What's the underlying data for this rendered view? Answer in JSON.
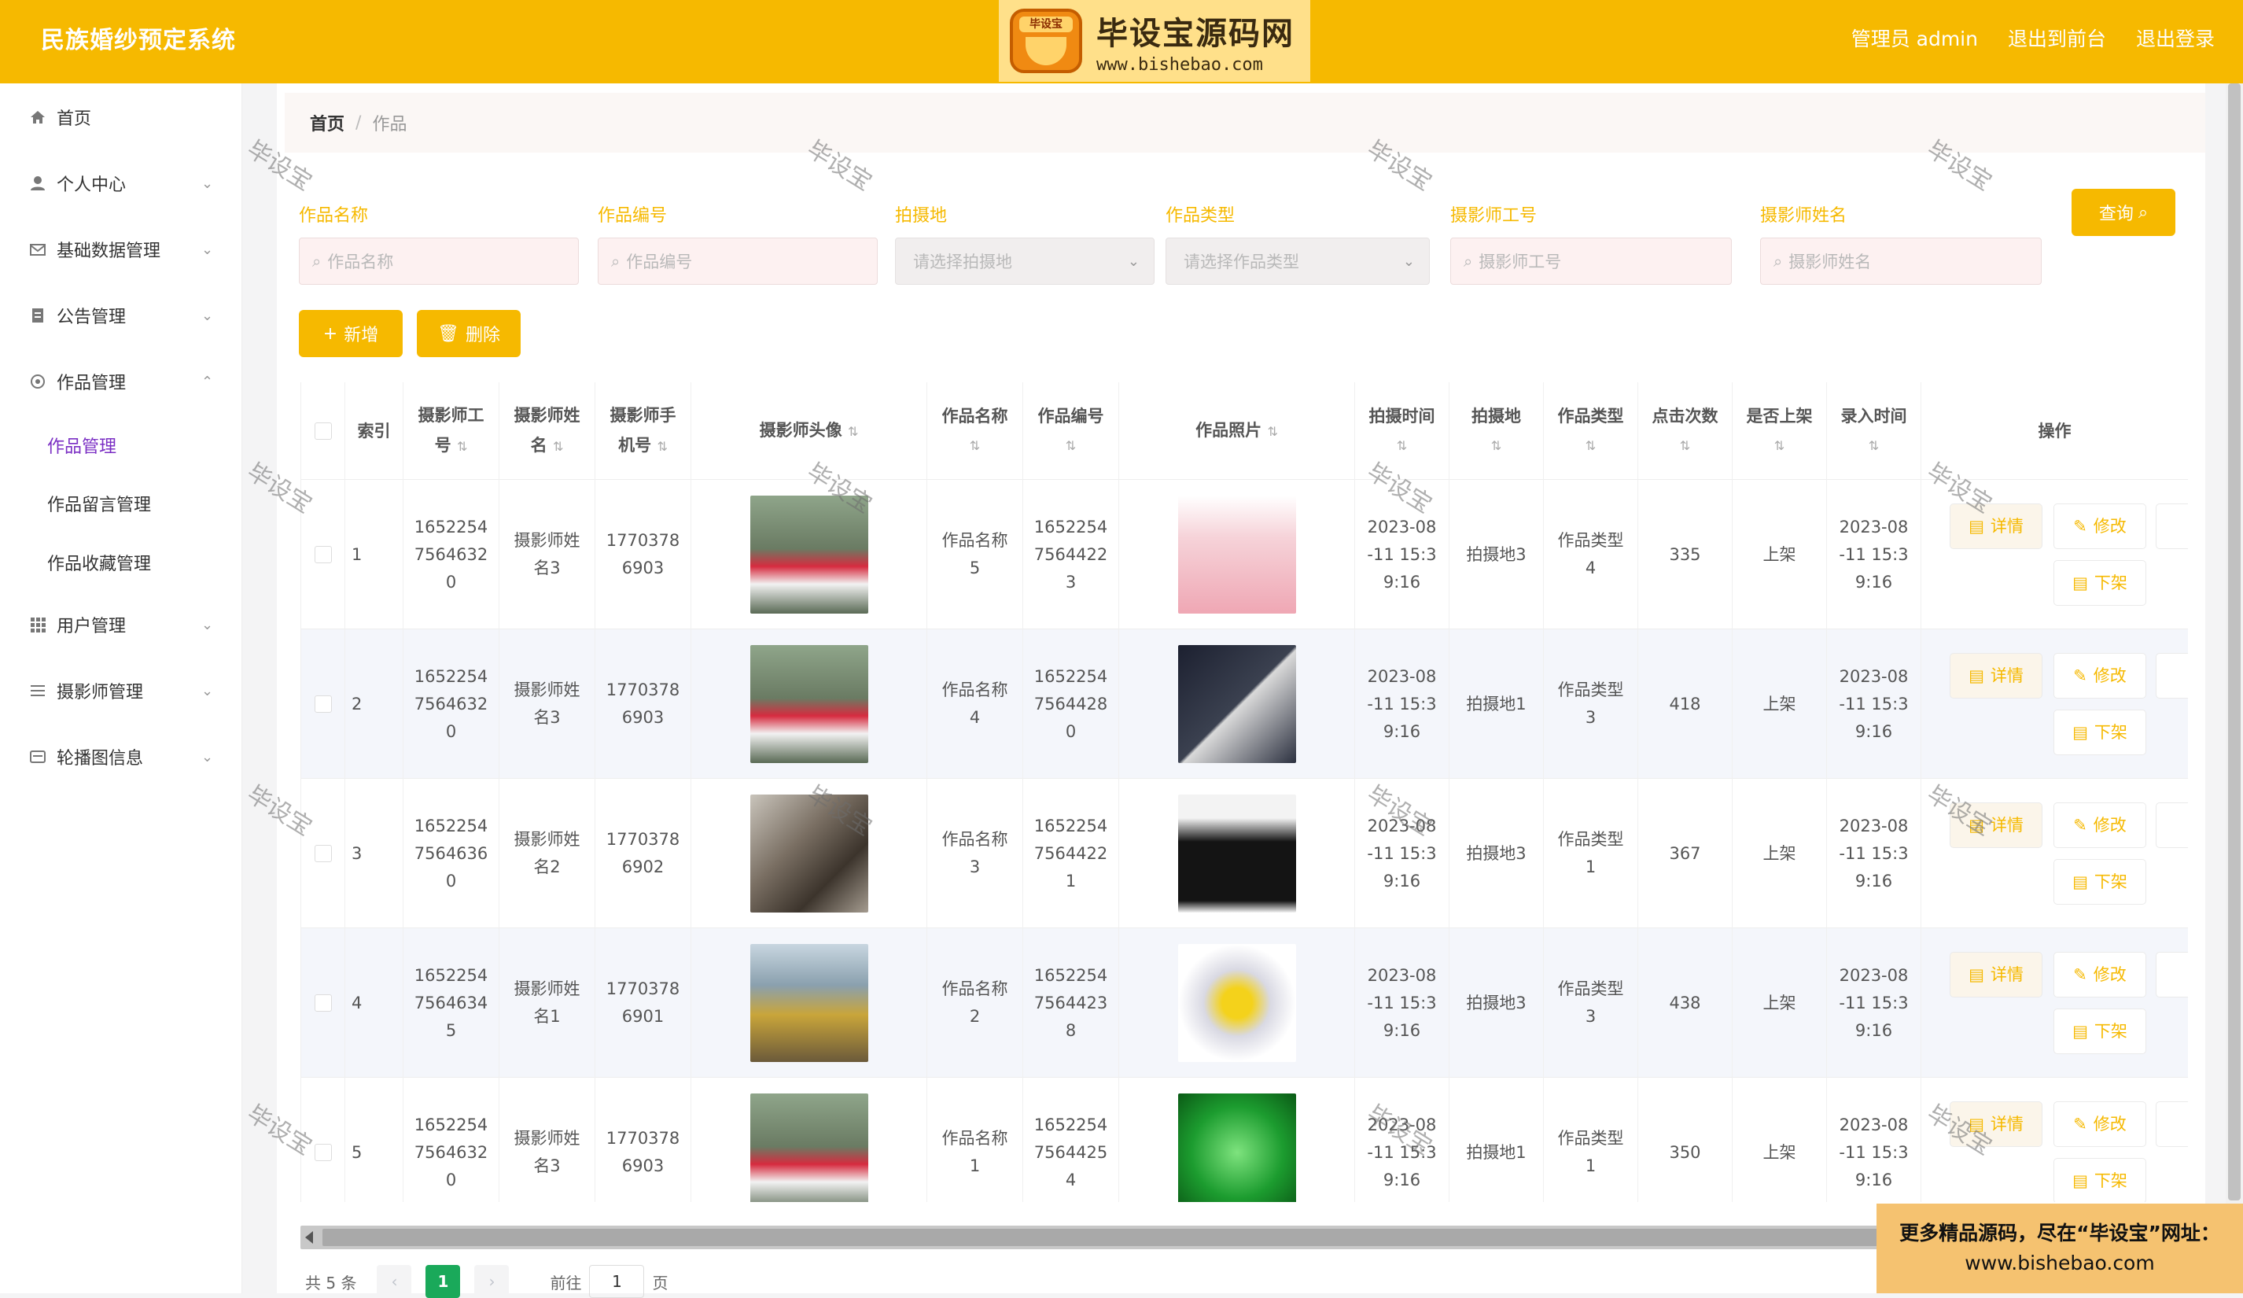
{
  "header": {
    "app_title": "民族婚纱预定系统",
    "logo_cn": "毕设宝源码网",
    "logo_url": "www.bishebao.com",
    "logo_badge": "毕设宝",
    "user_label": "管理员 admin",
    "front_link": "退出到前台",
    "logout_link": "退出登录",
    "accent": "#f6b900"
  },
  "sidebar": {
    "items": [
      {
        "label": "首页",
        "icon": "home-icon"
      },
      {
        "label": "个人中心",
        "icon": "user-icon"
      },
      {
        "label": "基础数据管理",
        "icon": "mail-icon"
      },
      {
        "label": "公告管理",
        "icon": "document-icon"
      },
      {
        "label": "作品管理",
        "icon": "settings-icon"
      },
      {
        "label": "用户管理",
        "icon": "grid-icon"
      },
      {
        "label": "摄影师管理",
        "icon": "list-icon"
      },
      {
        "label": "轮播图信息",
        "icon": "card-icon"
      }
    ],
    "sub_items": [
      "作品管理",
      "作品留言管理",
      "作品收藏管理"
    ]
  },
  "breadcrumb": {
    "home": "首页",
    "sep": "/",
    "current": "作品"
  },
  "filters": {
    "name_label": "作品名称",
    "name_placeholder": "作品名称",
    "code_label": "作品编号",
    "code_placeholder": "作品编号",
    "place_label": "拍摄地",
    "place_placeholder": "请选择拍摄地",
    "type_label": "作品类型",
    "type_placeholder": "请选择作品类型",
    "emp_label": "摄影师工号",
    "emp_placeholder": "摄影师工号",
    "pname_label": "摄影师姓名",
    "pname_placeholder": "摄影师姓名",
    "query_label": "查询"
  },
  "actions": {
    "add_label": "新增",
    "delete_label": "删除"
  },
  "table": {
    "headers": {
      "index": "索引",
      "emp_no": [
        "摄影师工",
        "号"
      ],
      "p_name": [
        "摄影师姓",
        "名"
      ],
      "p_phone": [
        "摄影师手",
        "机号"
      ],
      "avatar": "摄影师头像",
      "work_name": "作品名称",
      "work_code": "作品编号",
      "photo": "作品照片",
      "shoot_time": "拍摄时间",
      "place": "拍摄地",
      "type": "作品类型",
      "clicks": "点击次数",
      "on_shelf": "是否上架",
      "entry_time": "录入时间",
      "ops": "操作"
    },
    "rows": [
      {
        "index": "1",
        "emp_no": [
          "1652254",
          "7564632",
          "0"
        ],
        "p_name": [
          "摄影师姓",
          "名3"
        ],
        "p_phone": [
          "1770378",
          "6903"
        ],
        "avatar": "photographer-woman",
        "work_name": [
          "作品名称",
          "5"
        ],
        "work_code": [
          "1652254",
          "7564422",
          "3"
        ],
        "photo": "pink-drawer-box",
        "shoot_time": [
          "2023-08",
          "-11 15:3",
          "9:16"
        ],
        "place": "拍摄地3",
        "type": [
          "作品类型",
          "4"
        ],
        "clicks": "335",
        "on_shelf": "上架",
        "entry_time": [
          "2023-08",
          "-11 15:3",
          "9:16"
        ]
      },
      {
        "index": "2",
        "emp_no": [
          "1652254",
          "7564632",
          "0"
        ],
        "p_name": [
          "摄影师姓",
          "名3"
        ],
        "p_phone": [
          "1770378",
          "6903"
        ],
        "avatar": "photographer-woman",
        "work_name": [
          "作品名称",
          "4"
        ],
        "work_code": [
          "1652254",
          "7564428",
          "0"
        ],
        "photo": "hand-with-phone",
        "shoot_time": [
          "2023-08",
          "-11 15:3",
          "9:16"
        ],
        "place": "拍摄地1",
        "type": [
          "作品类型",
          "3"
        ],
        "clicks": "418",
        "on_shelf": "上架",
        "entry_time": [
          "2023-08",
          "-11 15:3",
          "9:16"
        ]
      },
      {
        "index": "3",
        "emp_no": [
          "1652254",
          "7564636",
          "0"
        ],
        "p_name": [
          "摄影师姓",
          "名2"
        ],
        "p_phone": [
          "1770378",
          "6902"
        ],
        "avatar": "studio-photographer",
        "work_name": [
          "作品名称",
          "3"
        ],
        "work_code": [
          "1652254",
          "7564422",
          "1"
        ],
        "photo": "man-black-sweater",
        "shoot_time": [
          "2023-08",
          "-11 15:3",
          "9:16"
        ],
        "place": "拍摄地3",
        "type": [
          "作品类型",
          "1"
        ],
        "clicks": "367",
        "on_shelf": "上架",
        "entry_time": [
          "2023-08",
          "-11 15:3",
          "9:16"
        ]
      },
      {
        "index": "4",
        "emp_no": [
          "1652254",
          "7564634",
          "5"
        ],
        "p_name": [
          "摄影师姓",
          "名1"
        ],
        "p_phone": [
          "1770378",
          "6901"
        ],
        "avatar": "wildlife-photographer",
        "work_name": [
          "作品名称",
          "2"
        ],
        "work_code": [
          "1652254",
          "7564423",
          "8"
        ],
        "photo": "yellow-diamond-ring",
        "shoot_time": [
          "2023-08",
          "-11 15:3",
          "9:16"
        ],
        "place": "拍摄地3",
        "type": [
          "作品类型",
          "3"
        ],
        "clicks": "438",
        "on_shelf": "上架",
        "entry_time": [
          "2023-08",
          "-11 15:3",
          "9:16"
        ]
      },
      {
        "index": "5",
        "emp_no": [
          "1652254",
          "7564632",
          "0"
        ],
        "p_name": [
          "摄影师姓",
          "名3"
        ],
        "p_phone": [
          "1770378",
          "6903"
        ],
        "avatar": "photographer-woman",
        "work_name": [
          "作品名称",
          "1"
        ],
        "work_code": [
          "1652254",
          "7564425",
          "4"
        ],
        "photo": "green-product-ad",
        "shoot_time": [
          "2023-08",
          "-11 15:3",
          "9:16"
        ],
        "place": "拍摄地1",
        "type": [
          "作品类型",
          "1"
        ],
        "clicks": "350",
        "on_shelf": "上架",
        "entry_time": [
          "2023-08",
          "-11 15:3",
          "9:16"
        ]
      }
    ],
    "op_labels": {
      "detail": "详情",
      "edit": "修改",
      "off_shelf": "下架"
    }
  },
  "pagination": {
    "total": "共 5 条",
    "prev": "‹",
    "current": "1",
    "next": "›",
    "goto": "前往",
    "goto_value": "1",
    "page_unit": "页"
  },
  "watermark": "毕设宝",
  "promo": {
    "line1": "更多精品源码，尽在“毕设宝”网址：",
    "line2": "www.bishebao.com"
  }
}
